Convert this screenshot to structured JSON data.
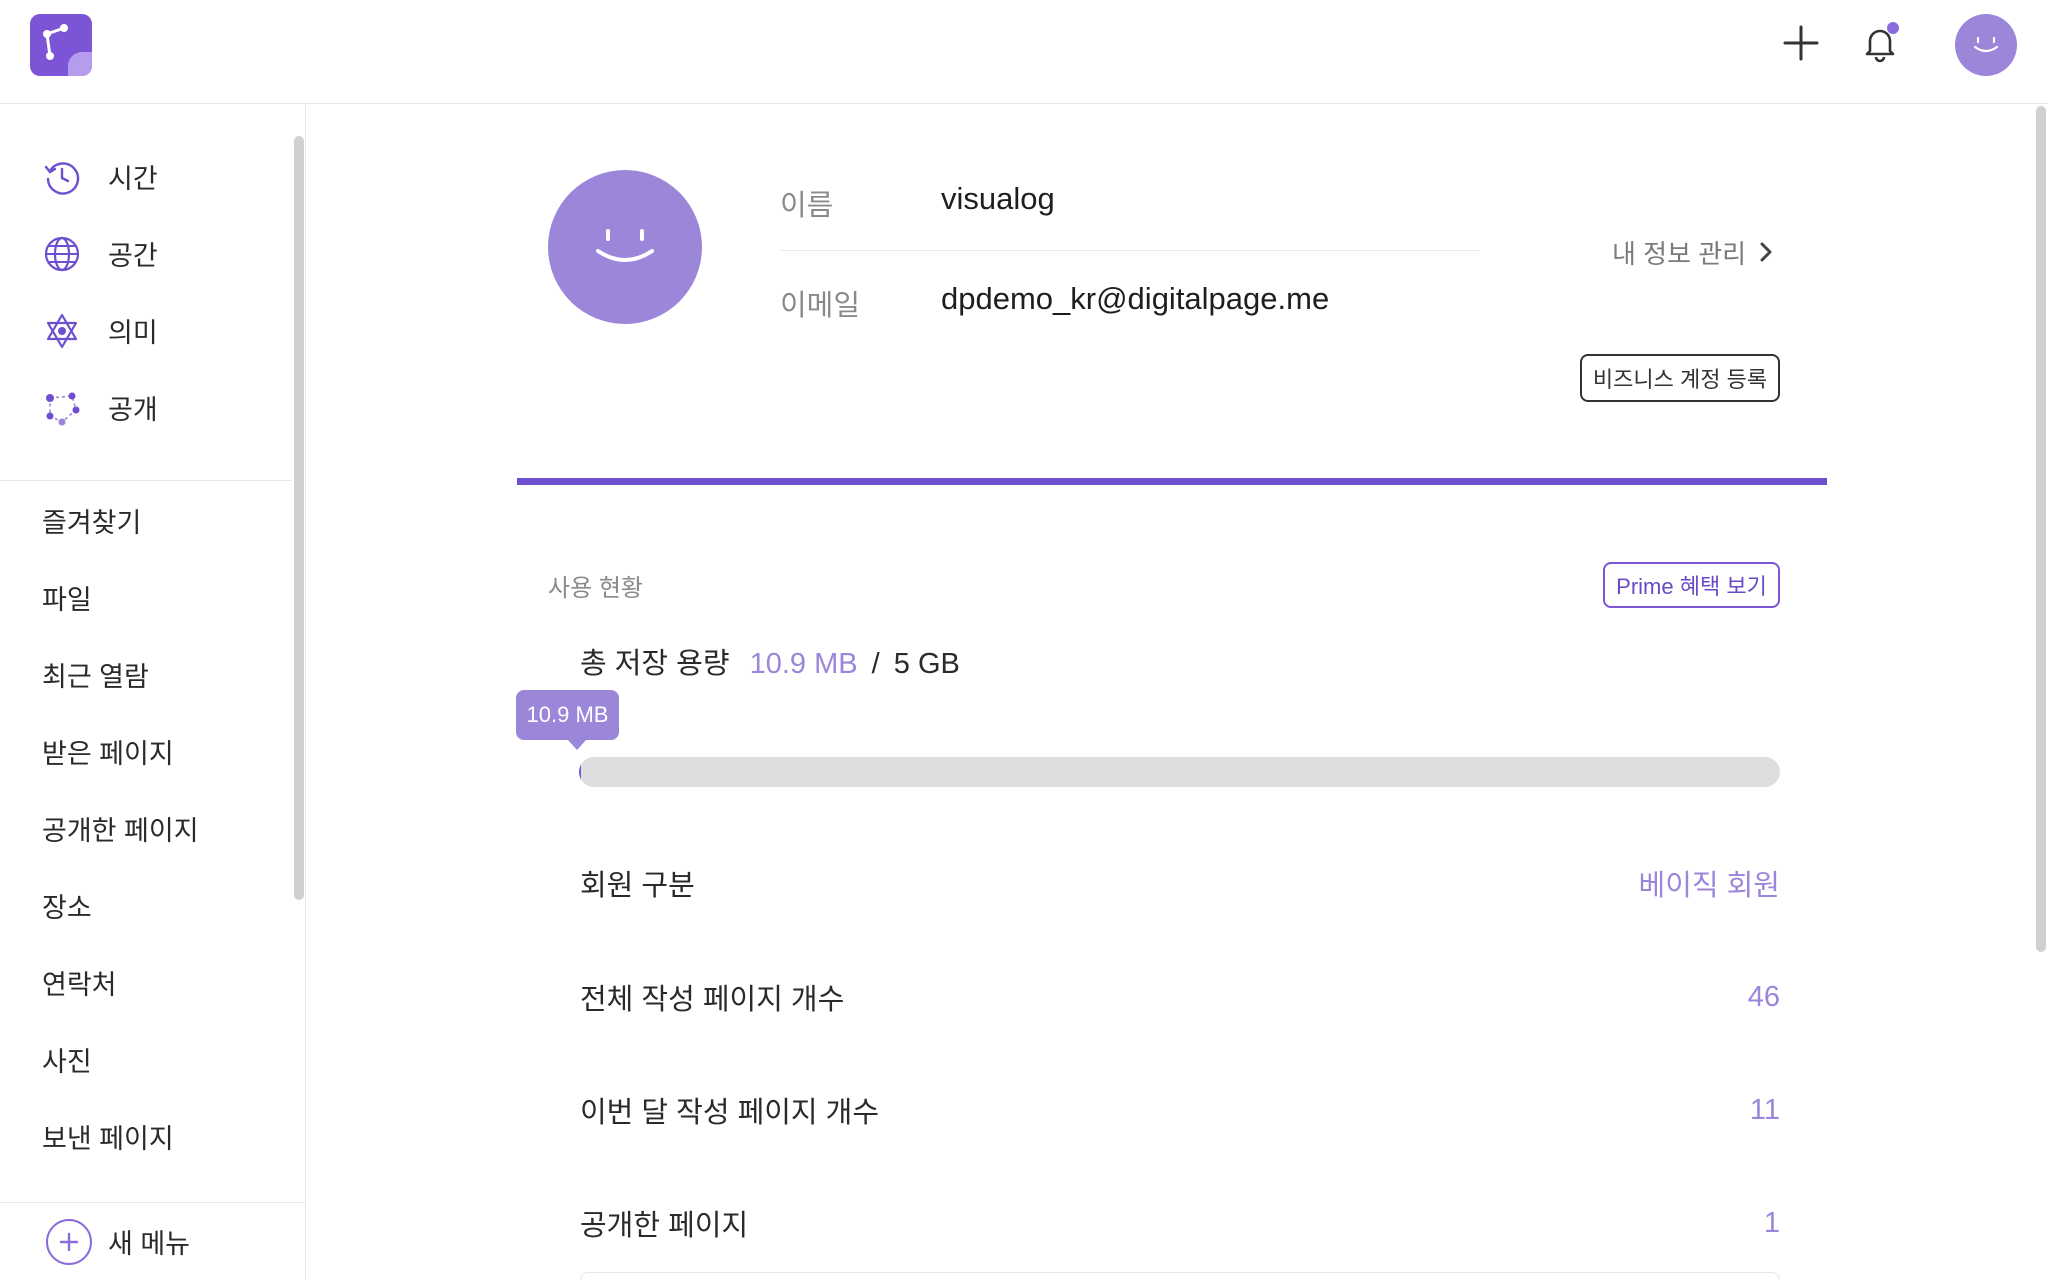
{
  "header": {
    "logo_icon": "app-logo-icon",
    "add_icon": "plus-icon",
    "notification_icon": "bell-icon",
    "notification_dot_color": "#8b6bdc",
    "avatar_icon": "smiley-avatar-icon"
  },
  "sidebar": {
    "main_items": [
      {
        "label": "시간",
        "icon": "clock-history-icon"
      },
      {
        "label": "공간",
        "icon": "globe-icon"
      },
      {
        "label": "의미",
        "icon": "network-star-icon"
      },
      {
        "label": "공개",
        "icon": "share-nodes-icon"
      }
    ],
    "sub_items": [
      {
        "label": "즐겨찾기"
      },
      {
        "label": "파일"
      },
      {
        "label": "최근 열람"
      },
      {
        "label": "받은 페이지"
      },
      {
        "label": "공개한 페이지"
      },
      {
        "label": "장소"
      },
      {
        "label": "연락처"
      },
      {
        "label": "사진"
      },
      {
        "label": "보낸 페이지"
      }
    ],
    "new_menu_label": "새 메뉴"
  },
  "profile": {
    "name_label": "이름",
    "name_value": "visualog",
    "email_label": "이메일",
    "email_value": "dpdemo_kr@digitalpage.me",
    "manage_label": "내 정보 관리",
    "business_button": "비즈니스 계정 등록"
  },
  "usage": {
    "title": "사용 현황",
    "prime_button": "Prime 혜택 보기",
    "storage_label": "총 저장 용량",
    "storage_used": "10.9 MB",
    "storage_separator": "/",
    "storage_total": "5 GB",
    "storage_tooltip": "10.9 MB",
    "storage_fraction": 0.002,
    "rows": [
      {
        "label": "회원 구분",
        "value": "베이직 회원"
      },
      {
        "label": "전체 작성 페이지 개수",
        "value": "46"
      },
      {
        "label": "이번 달 작성 페이지 개수",
        "value": "11"
      },
      {
        "label": "공개한 페이지",
        "value": "1"
      }
    ]
  },
  "colors": {
    "accent": "#7b55d6",
    "accent_light": "#9c86d9",
    "text": "#2a2a2a",
    "muted": "#8a8a8a"
  }
}
